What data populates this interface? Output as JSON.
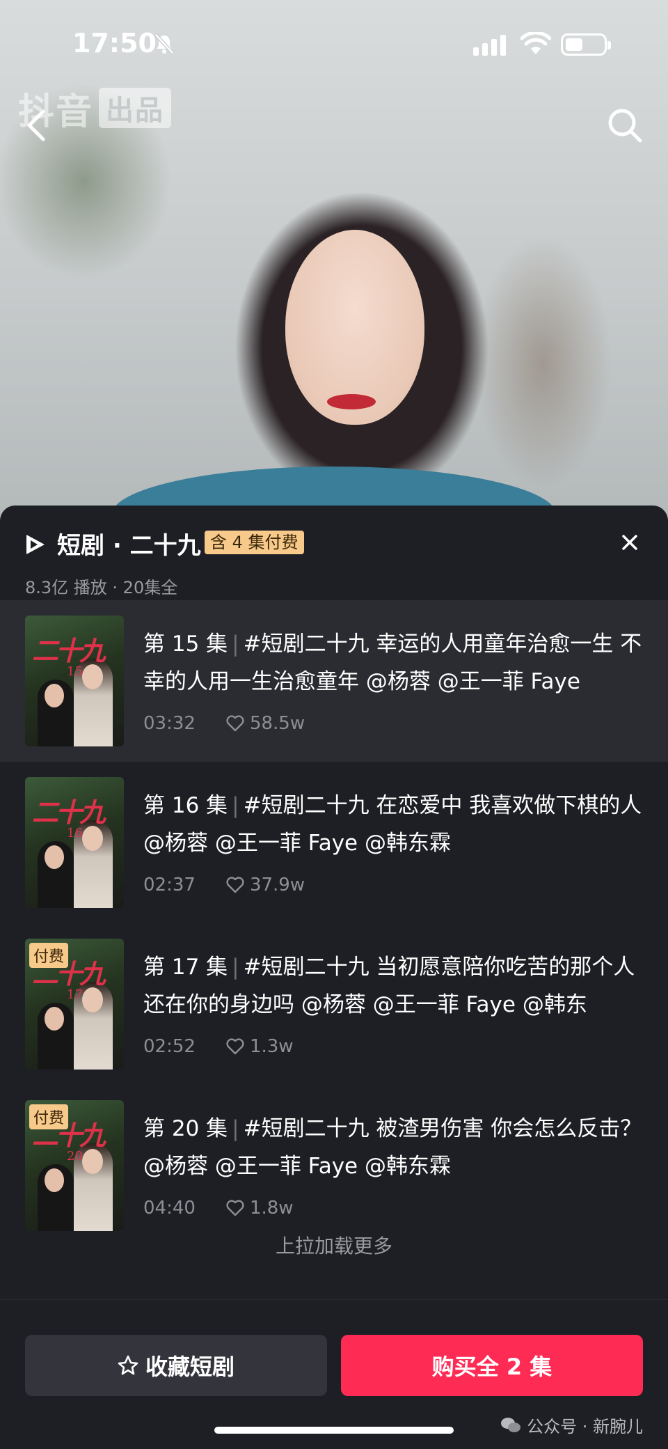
{
  "status_bar": {
    "time": "17:50"
  },
  "video": {
    "watermark_a": "抖音",
    "watermark_b": "出品"
  },
  "drama": {
    "title": "短剧 · 二十九",
    "paid_tag": "含 4 集付费",
    "subtitle": "8.3亿 播放 · 20集全"
  },
  "episodes": [
    {
      "ep_label": "第 15 集",
      "text": "#短剧二十九 幸运的人用童年治愈一生 不幸的人用一生治愈童年 @杨蓉 @王一菲 Faye",
      "duration": "03:32",
      "likes": "58.5w",
      "thumb_num": "15",
      "paid": ""
    },
    {
      "ep_label": "第 16 集",
      "text": "#短剧二十九 在恋爱中 我喜欢做下棋的人 @杨蓉 @王一菲 Faye @韩东霖",
      "duration": "02:37",
      "likes": "37.9w",
      "thumb_num": "16",
      "paid": ""
    },
    {
      "ep_label": "第 17 集",
      "text": "#短剧二十九 当初愿意陪你吃苦的那个人 还在你的身边吗 @杨蓉 @王一菲 Faye @韩东",
      "duration": "02:52",
      "likes": "1.3w",
      "thumb_num": "17",
      "paid": "付费"
    },
    {
      "ep_label": "第 20 集",
      "text": "#短剧二十九 被渣男伤害 你会怎么反击？ @杨蓉 @王一菲 Faye @韩东霖",
      "duration": "04:40",
      "likes": "1.8w",
      "thumb_num": "20",
      "paid": "付费"
    }
  ],
  "thumb_title": "二十九",
  "load_more": "上拉加载更多",
  "actions": {
    "favorite_label": "收藏短剧",
    "buy_label": "购买全 2 集"
  },
  "footer": {
    "wechat_label": "公众号 · 新腕儿"
  },
  "colors": {
    "accent": "#fe2c55",
    "tag_bg": "#f7c98a",
    "sheet_bg": "#1e1f25"
  }
}
